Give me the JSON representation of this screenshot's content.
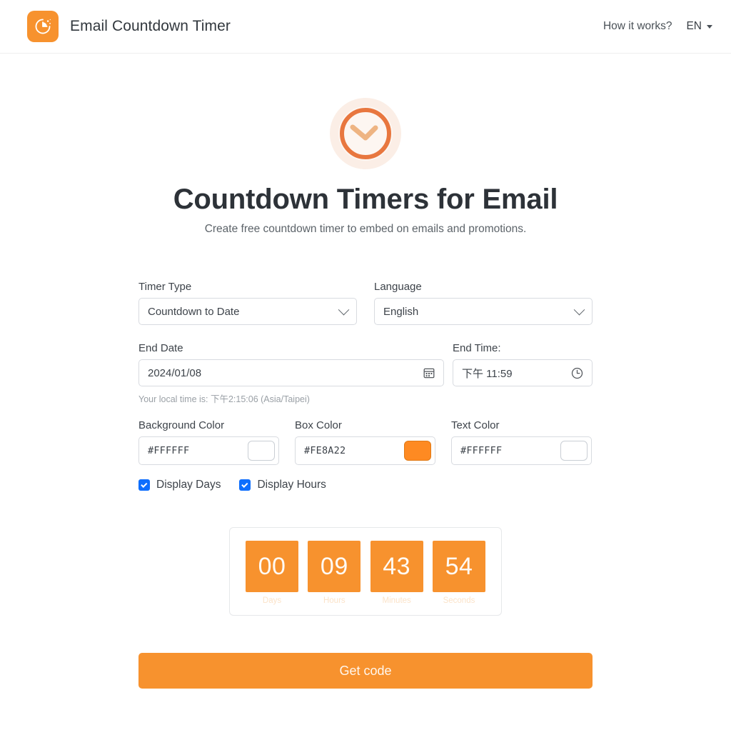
{
  "header": {
    "brand_title": "Email Countdown Timer",
    "logo_icon": "timer-pie-icon",
    "nav_link": "How it works?",
    "language_code": "EN",
    "caret_icon": "caret-down-icon"
  },
  "hero": {
    "icon": "clock-icon",
    "title": "Countdown Timers for Email",
    "subtitle": "Create free countdown timer to embed on emails and promotions."
  },
  "form": {
    "timer_type": {
      "label": "Timer Type",
      "value": "Countdown to Date",
      "icon": "chevron-down-icon"
    },
    "language": {
      "label": "Language",
      "value": "English",
      "icon": "chevron-down-icon"
    },
    "end_date": {
      "label": "End Date",
      "value": "2024/01/08",
      "icon": "calendar-icon"
    },
    "end_time": {
      "label": "End Time:",
      "value": "下午 11:59",
      "icon": "clock-icon"
    },
    "local_time": "Your local time is: 下午2:15:06 (Asia/Taipei)",
    "background_color": {
      "label": "Background Color",
      "value": "#FFFFFF",
      "swatch": "#FFFFFF"
    },
    "box_color": {
      "label": "Box Color",
      "value": "#FE8A22",
      "swatch": "#FE8A22"
    },
    "text_color": {
      "label": "Text Color",
      "value": "#FFFFFF",
      "swatch": "#FFFFFF"
    },
    "display_days": {
      "label": "Display Days",
      "checked": true
    },
    "display_hours": {
      "label": "Display Hours",
      "checked": true
    }
  },
  "preview": {
    "units": [
      {
        "value": "00",
        "label": "Days"
      },
      {
        "value": "09",
        "label": "Hours"
      },
      {
        "value": "43",
        "label": "Minutes"
      },
      {
        "value": "54",
        "label": "Seconds"
      }
    ]
  },
  "cta": {
    "label": "Get code"
  },
  "colors": {
    "brand_orange": "#F7922E",
    "box_orange": "#FE8A22",
    "checkbox_blue": "#0D6EFD",
    "text_dark": "#2D3238",
    "text_muted": "#9AA0A6",
    "border": "#D8DBE0"
  }
}
